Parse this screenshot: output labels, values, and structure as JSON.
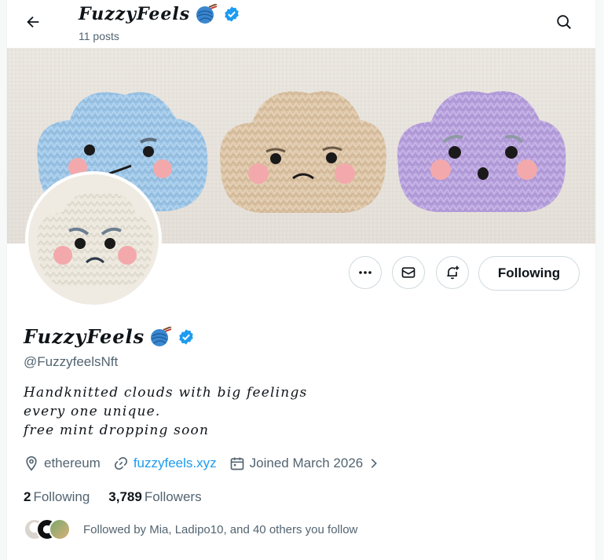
{
  "header": {
    "name": "FuzzyFeels",
    "post_count": "11 posts"
  },
  "profile": {
    "display_name": "FuzzyFeels",
    "handle": "@FuzzyfeelsNft",
    "bio_lines": [
      "Handknitted clouds with big feelings",
      "every one unique.",
      "free mint dropping soon"
    ],
    "location": "ethereum",
    "website": "fuzzyfeels.xyz",
    "joined": "Joined March 2026",
    "following_count": "2",
    "following_label": "Following",
    "followers_count": "3,789",
    "followers_label": "Followers",
    "followed_by": "Followed by Mia, Ladipo10, and 40 others you follow"
  },
  "actions": {
    "follow_label": "Following"
  },
  "colors": {
    "accent": "#1d9bf0",
    "verified": "#1d9bf0",
    "muted_text": "#536471",
    "cloud_blue": "#9cc6e8",
    "cloud_beige": "#dcc3a3",
    "cloud_purple": "#b7a0de",
    "cloud_cream": "#ebe6da"
  },
  "icons": {
    "back": "arrow-left-icon",
    "search": "search-icon",
    "more": "more-dots-icon",
    "message": "envelope-icon",
    "notify": "bell-plus-icon",
    "verified": "verified-badge-icon",
    "yarn": "yarn-ball-emoji-icon",
    "location": "location-pin-icon",
    "link": "link-icon",
    "calendar": "calendar-icon",
    "chevron": "chevron-right-icon"
  }
}
